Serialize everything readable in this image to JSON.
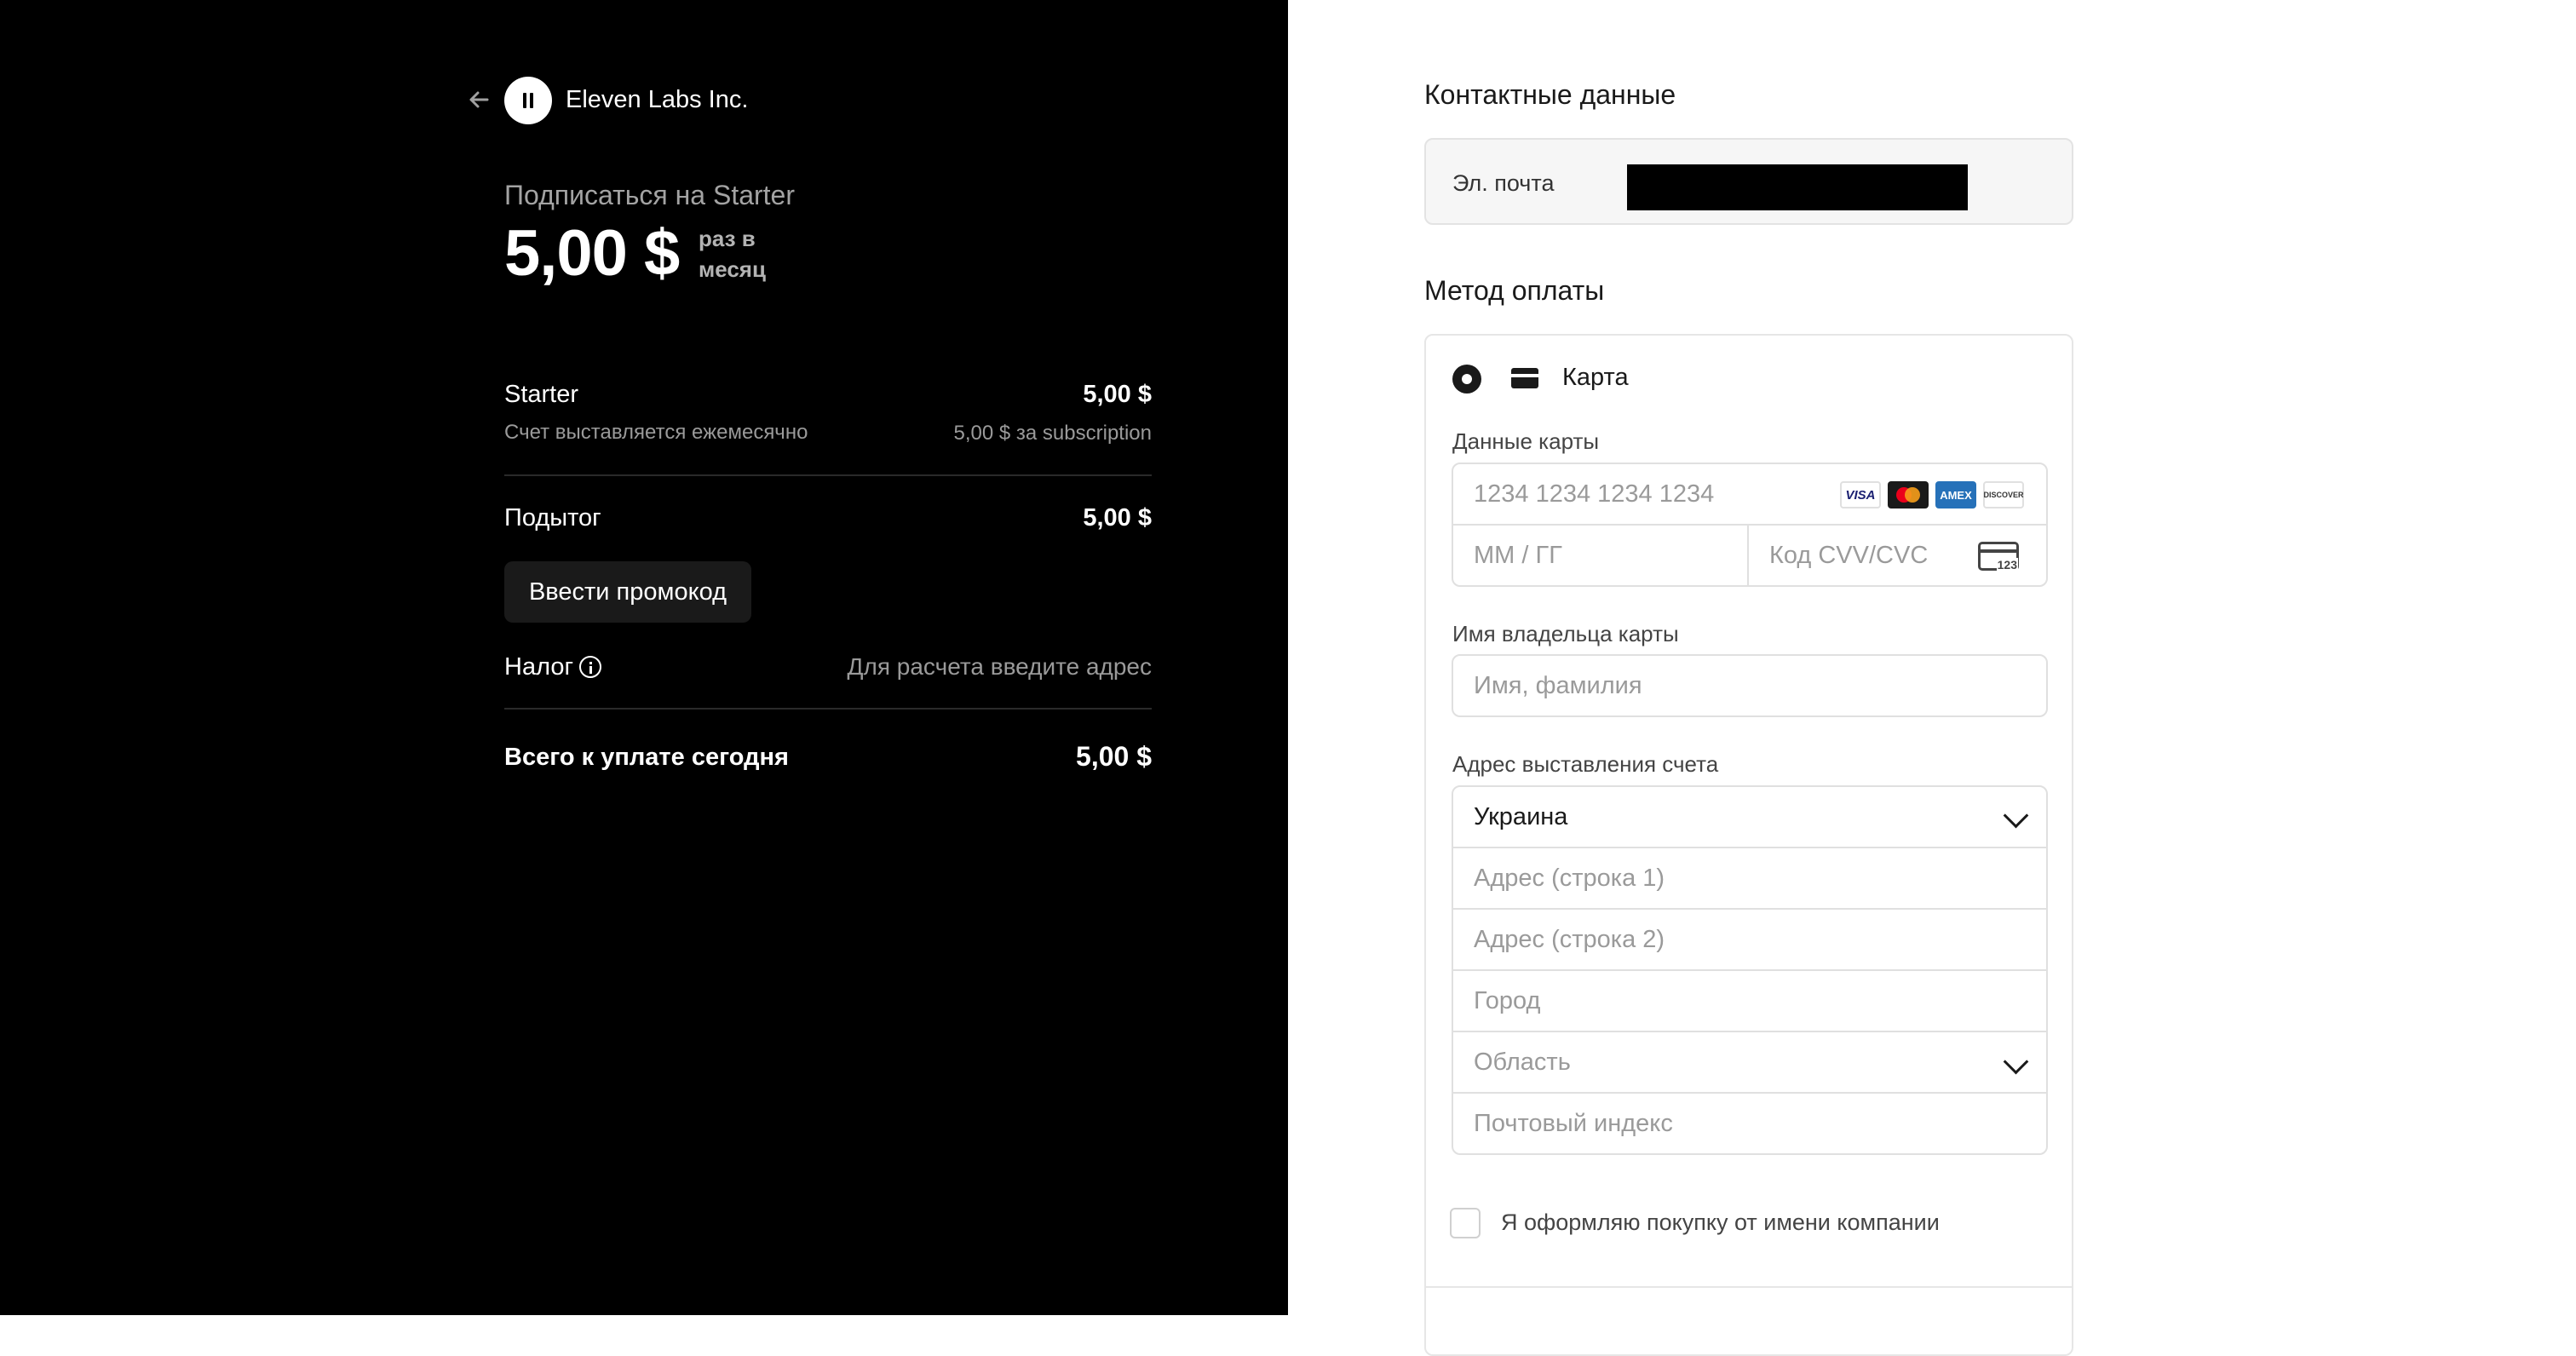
{
  "order": {
    "company": "Eleven Labs Inc.",
    "subscribe_title": "Подписаться на Starter",
    "price": "5,00 $",
    "period": "раз в месяц",
    "items": [
      {
        "name": "Starter",
        "value": "5,00 $",
        "subtitle": "Счет выставляется ежемесячно",
        "subvalue": "5,00 $ за subscription"
      }
    ],
    "subtotal_label": "Подытог",
    "subtotal_value": "5,00 $",
    "promo_button": "Ввести промокод",
    "tax_label": "Налог",
    "tax_value": "Для расчета введите адрес",
    "total_label": "Всего к уплате сегодня",
    "total_value": "5,00 $"
  },
  "contact": {
    "title": "Контактные данные",
    "email_label": "Эл. почта"
  },
  "payment": {
    "title": "Метод оплаты",
    "method_label": "Карта",
    "card_data_label": "Данные карты",
    "card_number_placeholder": "1234 1234 1234 1234",
    "brands": [
      "VISA",
      "mastercard",
      "AMEX",
      "DISCOVER"
    ],
    "expiry_placeholder": "ММ / ГГ",
    "cvc_placeholder": "Код CVV/CVC",
    "cvc_icon_text": "123",
    "cardholder_label": "Имя владельца карты",
    "cardholder_placeholder": "Имя, фамилия",
    "billing_label": "Адрес выставления счета",
    "country_value": "Украина",
    "address1_placeholder": "Адрес (строка 1)",
    "address2_placeholder": "Адрес (строка 2)",
    "city_placeholder": "Город",
    "region_placeholder": "Область",
    "postal_placeholder": "Почтовый индекс",
    "company_checkbox_label": "Я оформляю покупку от имени компании"
  }
}
